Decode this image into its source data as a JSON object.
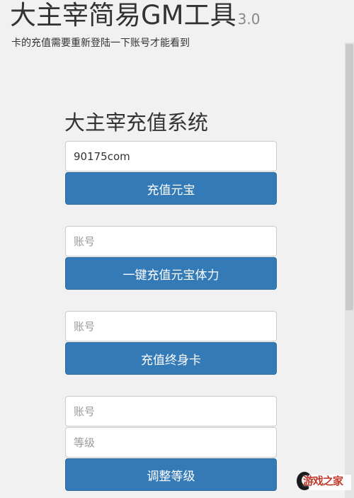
{
  "header": {
    "title": "大主宰简易GM工具",
    "version": "3.0",
    "subtitle": "卡的充值需要重新登陆一下账号才能看到"
  },
  "form": {
    "title": "大主宰充值系统",
    "recharge_yuanbao": {
      "input_value": "90175com",
      "button_label": "充值元宝"
    },
    "oneclick": {
      "account_placeholder": "账号",
      "button_label": "一键充值元宝体力"
    },
    "lifetime_card": {
      "account_placeholder": "账号",
      "button_label": "充值终身卡"
    },
    "adjust_level": {
      "account_placeholder": "账号",
      "level_placeholder": "等级",
      "button_label": "调整等级"
    }
  },
  "watermark": {
    "logo_text": "游戏之家"
  },
  "colors": {
    "background": "#f1f1f1",
    "button": "#337ab7",
    "button_border": "#2e6da4",
    "input_border": "#cccccc"
  }
}
